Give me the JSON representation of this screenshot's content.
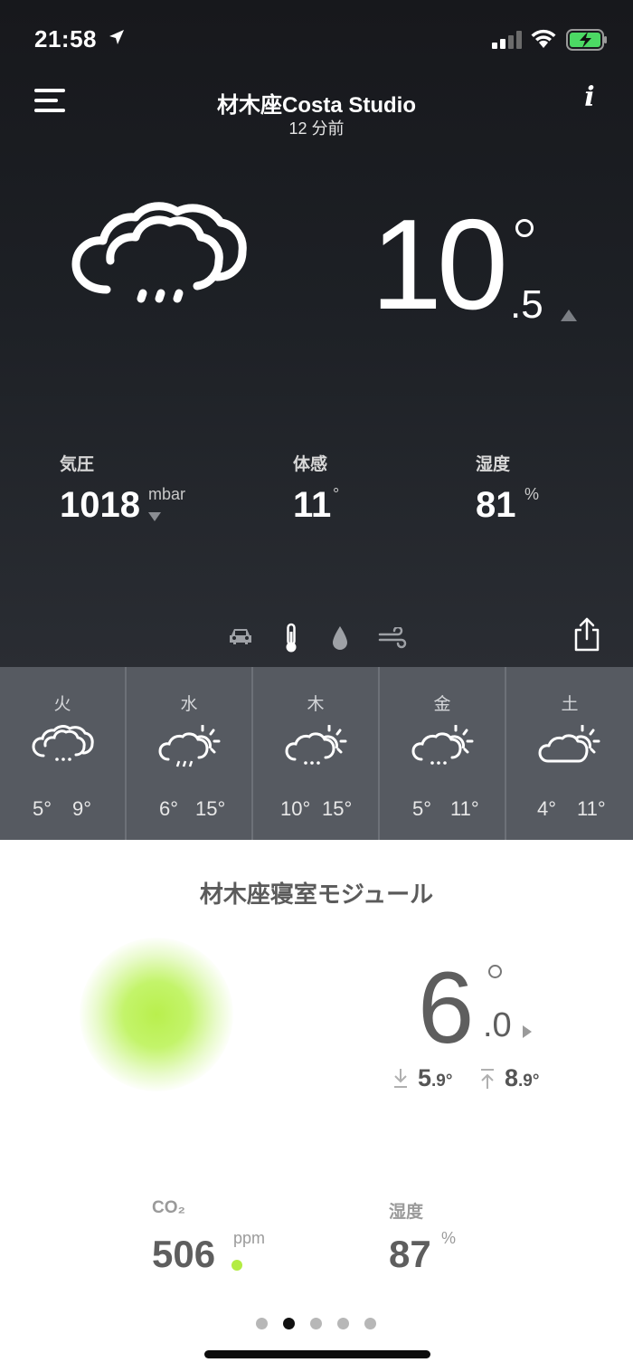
{
  "status": {
    "time": "21:58"
  },
  "header": {
    "title": "材木座Costa Studio",
    "subtitle": "12 分前"
  },
  "outdoor": {
    "temp_int": "10",
    "temp_dec": ".5",
    "metrics": [
      {
        "label": "気圧",
        "value": "1018",
        "unit": "mbar"
      },
      {
        "label": "体感",
        "value": "11",
        "unit": "°"
      },
      {
        "label": "湿度",
        "value": "81",
        "unit": "%"
      }
    ]
  },
  "forecast": [
    {
      "day": "火",
      "low": "5°",
      "high": "9°",
      "icon": "rain-cloud-icon"
    },
    {
      "day": "水",
      "low": "6°",
      "high": "15°",
      "icon": "partly-sunny-rain-icon"
    },
    {
      "day": "木",
      "low": "10°",
      "high": "15°",
      "icon": "partly-sunny-rain-icon"
    },
    {
      "day": "金",
      "low": "5°",
      "high": "11°",
      "icon": "partly-sunny-rain-icon"
    },
    {
      "day": "土",
      "low": "4°",
      "high": "11°",
      "icon": "partly-sunny-icon"
    }
  ],
  "module": {
    "title": "材木座寝室モジュール",
    "temp_int": "6",
    "temp_dec": ".0",
    "min_int": "5",
    "min_dec": ".9",
    "min_deg": "°",
    "max_int": "8",
    "max_dec": ".9",
    "max_deg": "°",
    "co2": {
      "label": "CO₂",
      "value": "506",
      "unit": "ppm"
    },
    "humidity": {
      "label": "湿度",
      "value": "87",
      "unit": "%"
    },
    "air_quality_color": "#b3ec43"
  },
  "pager": {
    "count": 5,
    "active": 1
  }
}
